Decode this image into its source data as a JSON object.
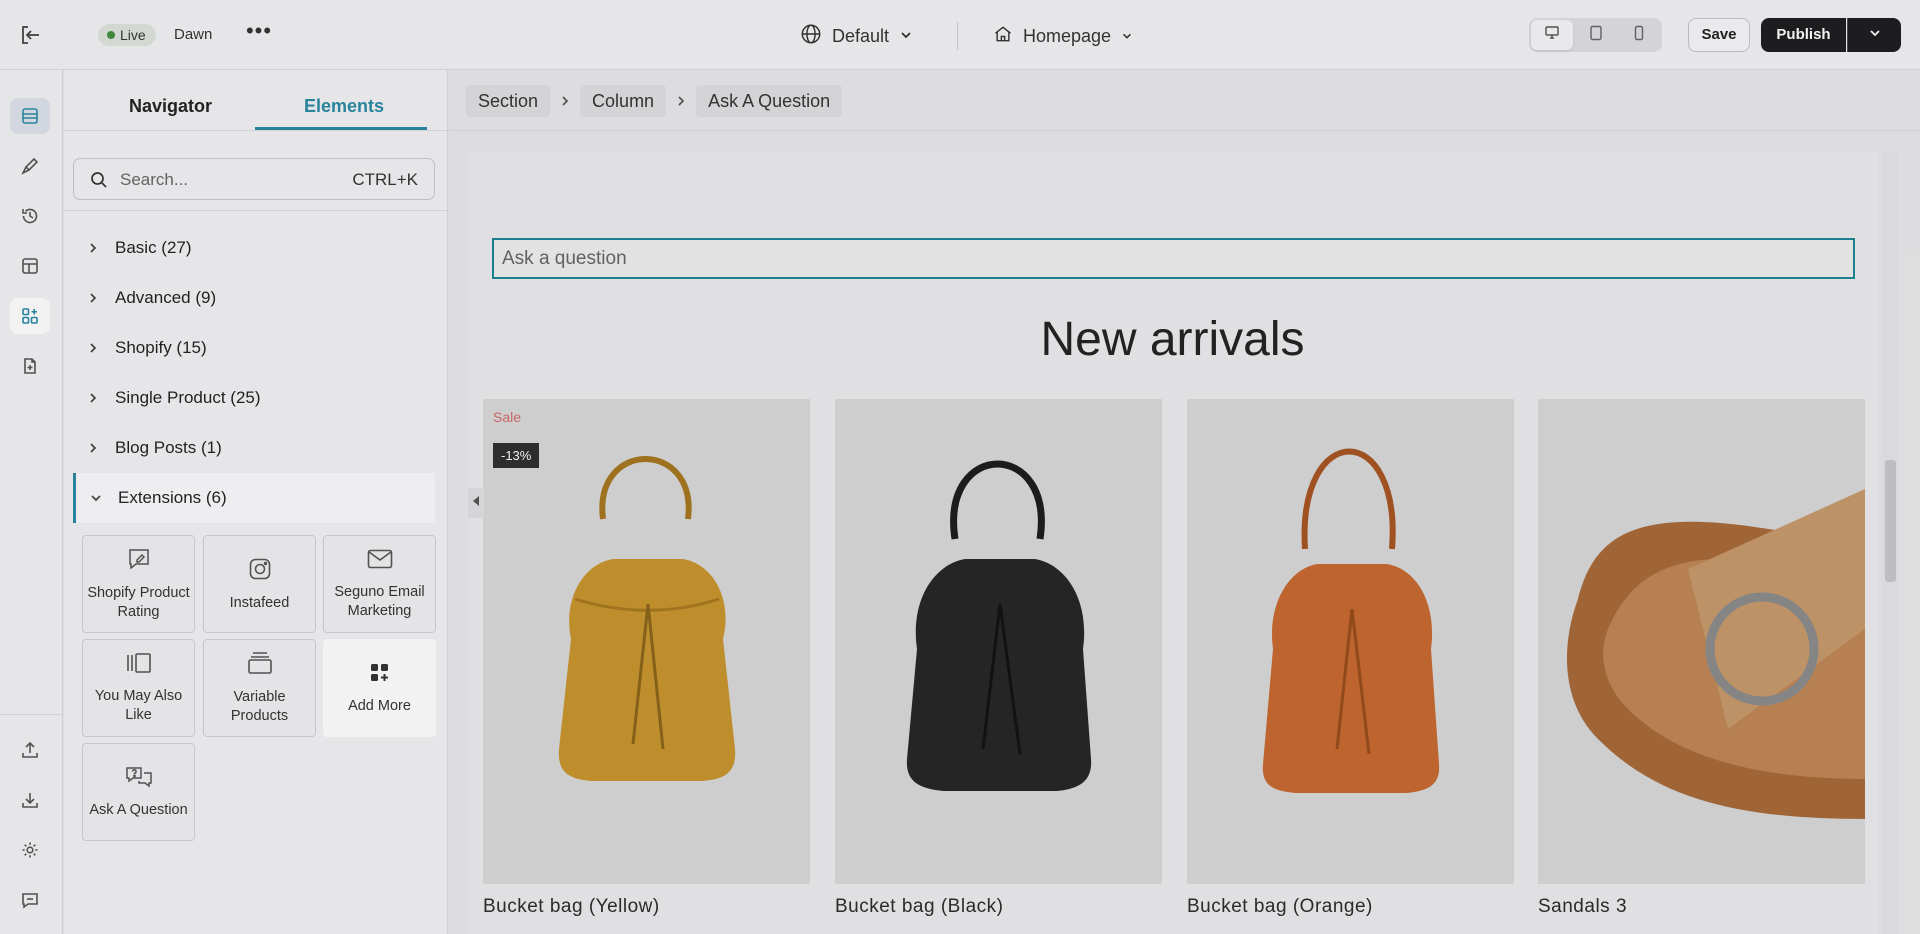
{
  "topbar": {
    "status": "Live",
    "theme": "Dawn",
    "locale": "Default",
    "page": "Homepage",
    "save_label": "Save",
    "publish_label": "Publish"
  },
  "panel": {
    "tabs": [
      {
        "label": "Navigator"
      },
      {
        "label": "Elements"
      }
    ],
    "active_tab": "Elements",
    "search_placeholder": "Search...",
    "search_shortcut": "CTRL+K",
    "categories": [
      {
        "label": "Basic (27)"
      },
      {
        "label": "Advanced (9)"
      },
      {
        "label": "Shopify (15)"
      },
      {
        "label": "Single Product (25)"
      },
      {
        "label": "Blog Posts (1)"
      },
      {
        "label": "Extensions (6)"
      }
    ],
    "extensions": [
      {
        "label": "Shopify Product Rating",
        "icon": "rating-icon"
      },
      {
        "label": "Instafeed",
        "icon": "instagram-icon"
      },
      {
        "label": "Seguno Email Marketing",
        "icon": "email-icon"
      },
      {
        "label": "You May Also Like",
        "icon": "carousel-icon"
      },
      {
        "label": "Variable Products",
        "icon": "stack-icon"
      },
      {
        "label": "Add More",
        "icon": "add-apps-icon"
      },
      {
        "label": "Ask A Question",
        "icon": "chat-question-icon"
      }
    ]
  },
  "breadcrumbs": [
    {
      "label": "Section"
    },
    {
      "label": "Column"
    },
    {
      "label": "Ask A Question"
    }
  ],
  "canvas": {
    "ask_placeholder": "Ask a question",
    "section_title": "New arrivals",
    "sale_badge": "Sale",
    "discount_badge": "-13%",
    "products": [
      {
        "name": "Bucket bag (Yellow)",
        "color": "#c8952c"
      },
      {
        "name": "Bucket bag (Black)",
        "color": "#222222"
      },
      {
        "name": "Bucket bag (Orange)",
        "color": "#c8692e"
      },
      {
        "name": "Sandals 3",
        "color": "#b07a48"
      }
    ]
  },
  "colors": {
    "accent": "#2a8aa3",
    "live": "#3f8f3b"
  }
}
